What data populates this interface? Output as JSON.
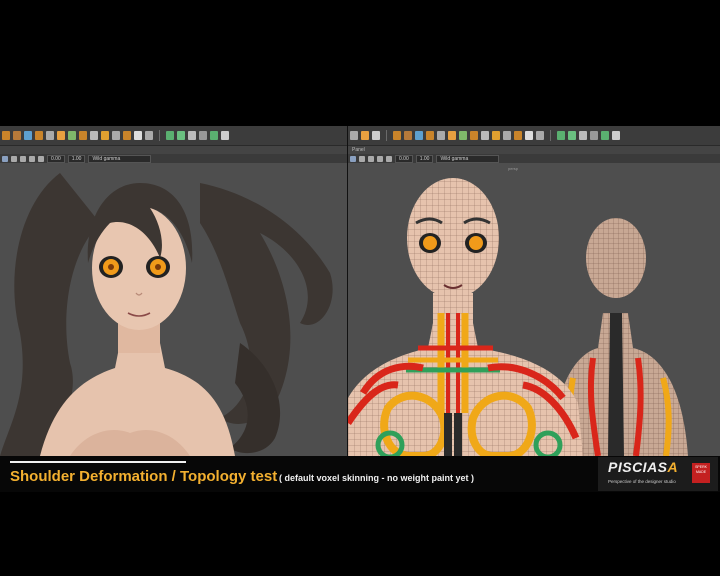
{
  "caption": {
    "title": "Shoulder Deformation / Topology test",
    "subtitle": "( default voxel skinning - no  weight paint yet )"
  },
  "brand": {
    "name_main": "PISCIAS",
    "name_accent": "A",
    "tagline": "Perspective of the designer studio",
    "badge": "SPERK MADE"
  },
  "left_viewport": {
    "field_a": "0.00",
    "field_b": "1.00",
    "camera": "Wild gamma"
  },
  "right_viewport": {
    "panel_menu": "Panel",
    "field_a": "0.00",
    "field_b": "1.00",
    "camera": "Wild gamma",
    "persp_label": "persp"
  },
  "colors": {
    "viewport_bg": "#4e4e4e",
    "toolbar_bg": "#3c3c3c",
    "caption_accent": "#f3b030",
    "skin": "#e6c3ad",
    "hair": "#3c3632",
    "eye": "#f09a1a",
    "weight_red": "#d9261a",
    "weight_orange": "#f0a818",
    "weight_green": "#2fa05a"
  }
}
